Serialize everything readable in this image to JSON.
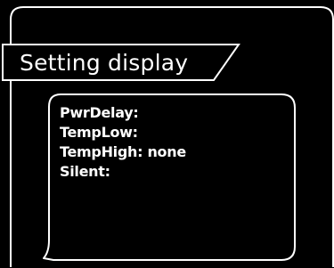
{
  "settings_panel": {
    "title": "Setting display",
    "items": [
      {
        "label": "PwrDelay:",
        "value": ""
      },
      {
        "label": "TempLow:",
        "value": ""
      },
      {
        "label": "TempHigh:",
        "value": "none"
      },
      {
        "label": "Silent:",
        "value": ""
      }
    ]
  },
  "colors": {
    "background": "#000000",
    "foreground": "#ffffff"
  }
}
